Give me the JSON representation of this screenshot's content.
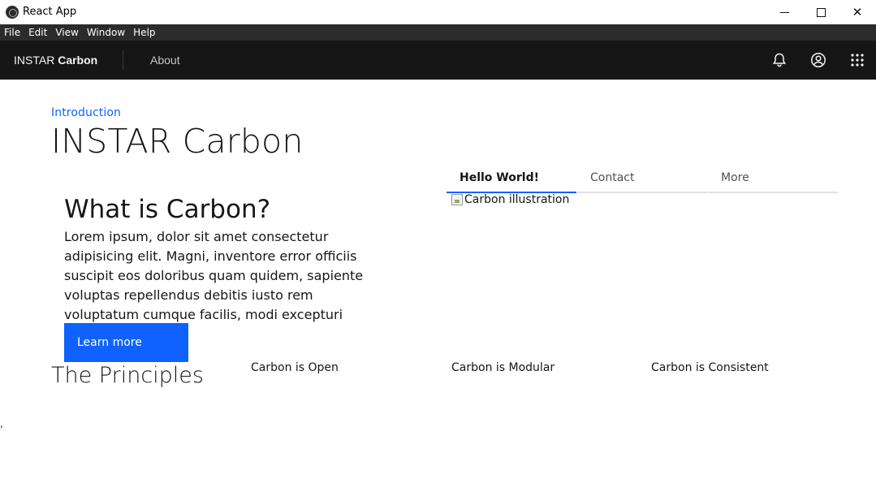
{
  "window": {
    "title": "React App",
    "controls": {
      "minimize": "minimize-icon",
      "maximize": "maximize-icon",
      "close": "✕"
    }
  },
  "menubar": {
    "items": [
      "File",
      "Edit",
      "View",
      "Window",
      "Help"
    ]
  },
  "header": {
    "brand_prefix": "INSTAR",
    "brand_suffix": "Carbon",
    "nav": [
      "About"
    ],
    "icons": [
      "notification-icon",
      "user-avatar-icon",
      "app-switcher-icon"
    ]
  },
  "landing": {
    "breadcrumb": "Introduction",
    "title": "INSTAR Carbon",
    "tabs": [
      "Hello World!",
      "Contact",
      "More"
    ],
    "active_tab": "Hello World!",
    "illustration_alt": "Carbon illustration",
    "section_heading": "What is Carbon?",
    "body": "Lorem ipsum, dolor sit amet consectetur adipisicing elit. Magni, inventore error officiis suscipit eos doloribus quam quidem, sapiente voluptas repellendus debitis iusto rem voluptatum cumque facilis, modi excepturi minus officia?",
    "cta_label": "Learn more"
  },
  "principles": {
    "title": "The Principles",
    "items": [
      "Carbon is Open",
      "Carbon is Modular",
      "Carbon is Consistent"
    ]
  },
  "stray_text": ","
}
